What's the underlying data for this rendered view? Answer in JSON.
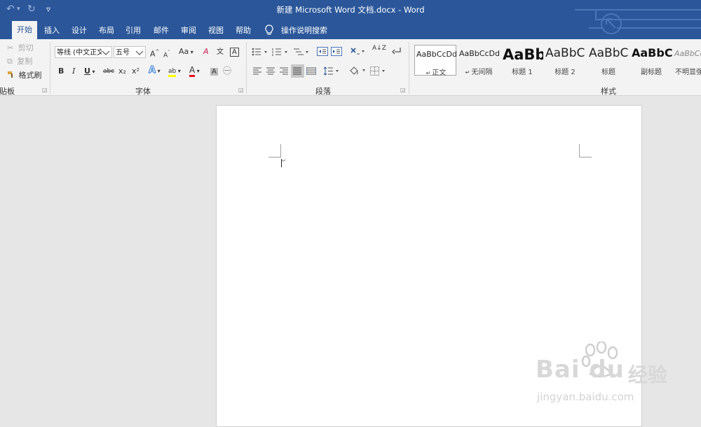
{
  "window": {
    "title": "新建 Microsoft Word 文档.docx  -  Word"
  },
  "qat": {
    "undo": "↶",
    "undo_drop": "▾",
    "redo": "↻",
    "customize": "▿"
  },
  "tabs": [
    "开始",
    "插入",
    "设计",
    "布局",
    "引用",
    "邮件",
    "审阅",
    "视图",
    "帮助"
  ],
  "tell_me": "操作说明搜索",
  "clipboard": {
    "group_label": "剪贴板",
    "cut": "剪切",
    "copy": "复制",
    "format_painter": "格式刷"
  },
  "font": {
    "group_label": "字体",
    "font_name": "等线 (中文正文)",
    "font_size": "五号",
    "grow": "A",
    "shrink": "A",
    "case": "Aa",
    "clear": "A",
    "phonetic": "文",
    "border_char": "A",
    "bold": "B",
    "italic": "I",
    "underline": "U",
    "strike": "abc",
    "sub": "x₂",
    "sup": "x²",
    "effects": "A",
    "highlight": "ab",
    "color": "A",
    "shade": "A",
    "enclose": "㊀",
    "highlight_color": "#ffff00",
    "font_color": "#e81123"
  },
  "paragraph": {
    "group_label": "段落",
    "sort": "A↓Z"
  },
  "styles": {
    "group_label": "样式",
    "items": [
      {
        "sample": "AaBbCcDd",
        "name": "正文",
        "mark": "↵",
        "selected": true,
        "size": "11px",
        "weight": "normal",
        "style": "normal",
        "color": "#222"
      },
      {
        "sample": "AaBbCcDd",
        "name": "无间隔",
        "mark": "↵",
        "selected": false,
        "size": "11px",
        "weight": "normal",
        "style": "normal",
        "color": "#222"
      },
      {
        "sample": "AaBb",
        "name": "标题 1",
        "mark": "",
        "selected": false,
        "size": "21px",
        "weight": "bold",
        "style": "normal",
        "color": "#111"
      },
      {
        "sample": "AaBbC",
        "name": "标题 2",
        "mark": "",
        "selected": false,
        "size": "17px",
        "weight": "normal",
        "style": "normal",
        "color": "#222"
      },
      {
        "sample": "AaBbC",
        "name": "标题",
        "mark": "",
        "selected": false,
        "size": "17px",
        "weight": "normal",
        "style": "normal",
        "color": "#222"
      },
      {
        "sample": "AaBbC",
        "name": "副标题",
        "mark": "",
        "selected": false,
        "size": "16px",
        "weight": "bold",
        "style": "normal",
        "color": "#111"
      },
      {
        "sample": "AaBbCcDd",
        "name": "不明显强调",
        "mark": "",
        "selected": false,
        "size": "11px",
        "weight": "normal",
        "style": "italic",
        "color": "#888"
      }
    ]
  },
  "document": {
    "paragraph_mark": "↵"
  },
  "watermark": {
    "brand": "Bai du",
    "cn": "经验",
    "url": "jingyan.baidu.com"
  }
}
